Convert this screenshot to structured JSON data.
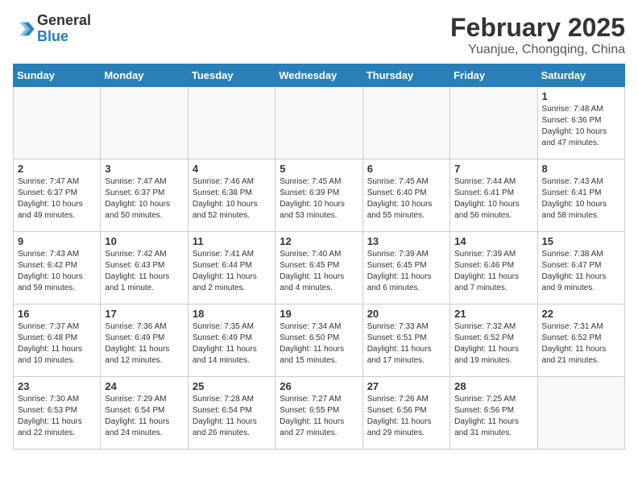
{
  "header": {
    "logo_general": "General",
    "logo_blue": "Blue",
    "month_title": "February 2025",
    "location": "Yuanjue, Chongqing, China"
  },
  "weekdays": [
    "Sunday",
    "Monday",
    "Tuesday",
    "Wednesday",
    "Thursday",
    "Friday",
    "Saturday"
  ],
  "weeks": [
    [
      {
        "day": "",
        "info": ""
      },
      {
        "day": "",
        "info": ""
      },
      {
        "day": "",
        "info": ""
      },
      {
        "day": "",
        "info": ""
      },
      {
        "day": "",
        "info": ""
      },
      {
        "day": "",
        "info": ""
      },
      {
        "day": "1",
        "info": "Sunrise: 7:48 AM\nSunset: 6:36 PM\nDaylight: 10 hours\nand 47 minutes."
      }
    ],
    [
      {
        "day": "2",
        "info": "Sunrise: 7:47 AM\nSunset: 6:37 PM\nDaylight: 10 hours\nand 49 minutes."
      },
      {
        "day": "3",
        "info": "Sunrise: 7:47 AM\nSunset: 6:37 PM\nDaylight: 10 hours\nand 50 minutes."
      },
      {
        "day": "4",
        "info": "Sunrise: 7:46 AM\nSunset: 6:38 PM\nDaylight: 10 hours\nand 52 minutes."
      },
      {
        "day": "5",
        "info": "Sunrise: 7:45 AM\nSunset: 6:39 PM\nDaylight: 10 hours\nand 53 minutes."
      },
      {
        "day": "6",
        "info": "Sunrise: 7:45 AM\nSunset: 6:40 PM\nDaylight: 10 hours\nand 55 minutes."
      },
      {
        "day": "7",
        "info": "Sunrise: 7:44 AM\nSunset: 6:41 PM\nDaylight: 10 hours\nand 56 minutes."
      },
      {
        "day": "8",
        "info": "Sunrise: 7:43 AM\nSunset: 6:41 PM\nDaylight: 10 hours\nand 58 minutes."
      }
    ],
    [
      {
        "day": "9",
        "info": "Sunrise: 7:43 AM\nSunset: 6:42 PM\nDaylight: 10 hours\nand 59 minutes."
      },
      {
        "day": "10",
        "info": "Sunrise: 7:42 AM\nSunset: 6:43 PM\nDaylight: 11 hours\nand 1 minute."
      },
      {
        "day": "11",
        "info": "Sunrise: 7:41 AM\nSunset: 6:44 PM\nDaylight: 11 hours\nand 2 minutes."
      },
      {
        "day": "12",
        "info": "Sunrise: 7:40 AM\nSunset: 6:45 PM\nDaylight: 11 hours\nand 4 minutes."
      },
      {
        "day": "13",
        "info": "Sunrise: 7:39 AM\nSunset: 6:45 PM\nDaylight: 11 hours\nand 6 minutes."
      },
      {
        "day": "14",
        "info": "Sunrise: 7:39 AM\nSunset: 6:46 PM\nDaylight: 11 hours\nand 7 minutes."
      },
      {
        "day": "15",
        "info": "Sunrise: 7:38 AM\nSunset: 6:47 PM\nDaylight: 11 hours\nand 9 minutes."
      }
    ],
    [
      {
        "day": "16",
        "info": "Sunrise: 7:37 AM\nSunset: 6:48 PM\nDaylight: 11 hours\nand 10 minutes."
      },
      {
        "day": "17",
        "info": "Sunrise: 7:36 AM\nSunset: 6:49 PM\nDaylight: 11 hours\nand 12 minutes."
      },
      {
        "day": "18",
        "info": "Sunrise: 7:35 AM\nSunset: 6:49 PM\nDaylight: 11 hours\nand 14 minutes."
      },
      {
        "day": "19",
        "info": "Sunrise: 7:34 AM\nSunset: 6:50 PM\nDaylight: 11 hours\nand 15 minutes."
      },
      {
        "day": "20",
        "info": "Sunrise: 7:33 AM\nSunset: 6:51 PM\nDaylight: 11 hours\nand 17 minutes."
      },
      {
        "day": "21",
        "info": "Sunrise: 7:32 AM\nSunset: 6:52 PM\nDaylight: 11 hours\nand 19 minutes."
      },
      {
        "day": "22",
        "info": "Sunrise: 7:31 AM\nSunset: 6:52 PM\nDaylight: 11 hours\nand 21 minutes."
      }
    ],
    [
      {
        "day": "23",
        "info": "Sunrise: 7:30 AM\nSunset: 6:53 PM\nDaylight: 11 hours\nand 22 minutes."
      },
      {
        "day": "24",
        "info": "Sunrise: 7:29 AM\nSunset: 6:54 PM\nDaylight: 11 hours\nand 24 minutes."
      },
      {
        "day": "25",
        "info": "Sunrise: 7:28 AM\nSunset: 6:54 PM\nDaylight: 11 hours\nand 26 minutes."
      },
      {
        "day": "26",
        "info": "Sunrise: 7:27 AM\nSunset: 6:55 PM\nDaylight: 11 hours\nand 27 minutes."
      },
      {
        "day": "27",
        "info": "Sunrise: 7:26 AM\nSunset: 6:56 PM\nDaylight: 11 hours\nand 29 minutes."
      },
      {
        "day": "28",
        "info": "Sunrise: 7:25 AM\nSunset: 6:56 PM\nDaylight: 11 hours\nand 31 minutes."
      },
      {
        "day": "",
        "info": ""
      }
    ]
  ]
}
